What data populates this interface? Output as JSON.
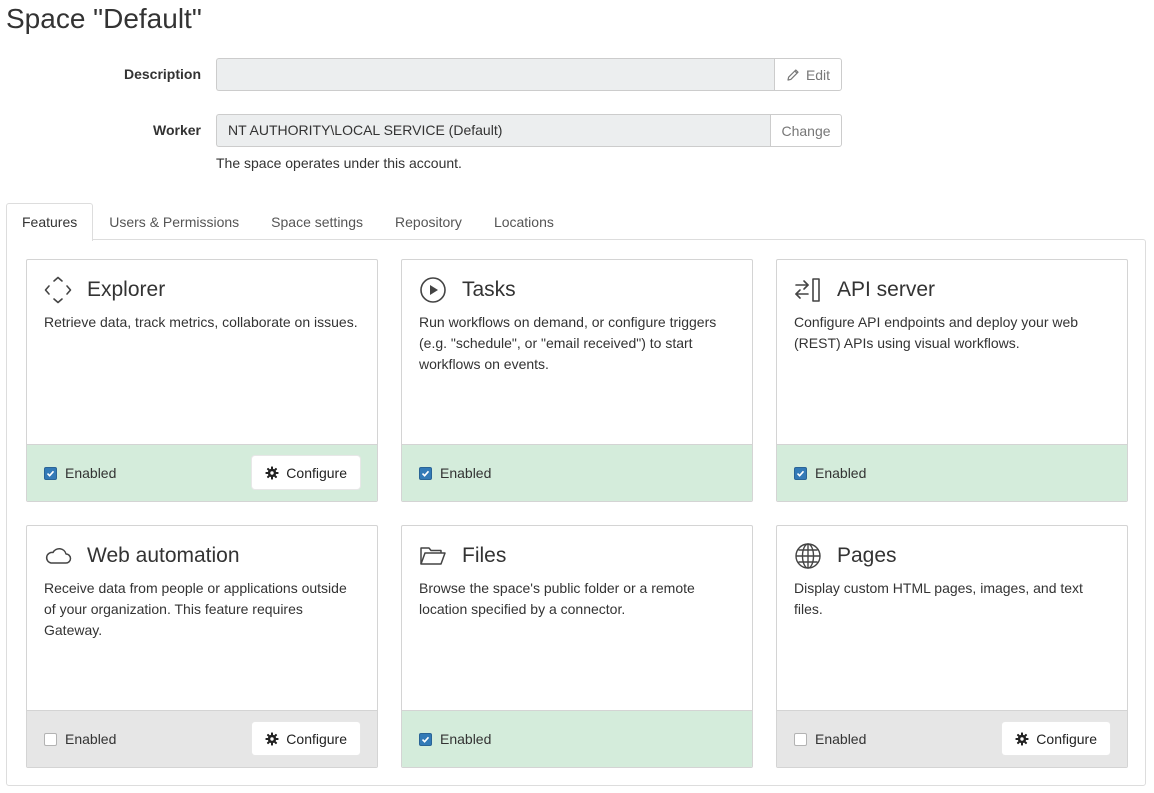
{
  "page": {
    "title": "Space \"Default\""
  },
  "form": {
    "description": {
      "label": "Description",
      "value": "",
      "button": "Edit"
    },
    "worker": {
      "label": "Worker",
      "value": "NT AUTHORITY\\LOCAL SERVICE (Default)",
      "button": "Change",
      "help": "The space operates under this account."
    }
  },
  "tabs": [
    "Features",
    "Users & Permissions",
    "Space settings",
    "Repository",
    "Locations"
  ],
  "features": [
    {
      "title": "Explorer",
      "icon": "explorer-diamond-icon",
      "description": "Retrieve data, track metrics, collaborate on issues.",
      "enabled_label": "Enabled",
      "enabled": true,
      "configure": "Configure"
    },
    {
      "title": "Tasks",
      "icon": "play-circle-icon",
      "description": "Run workflows on demand, or configure triggers (e.g. \"schedule\", or \"email received\") to start workflows on events.",
      "enabled_label": "Enabled",
      "enabled": true
    },
    {
      "title": "API server",
      "icon": "api-exchange-icon",
      "description": "Configure API endpoints and deploy your web (REST) APIs using visual workflows.",
      "enabled_label": "Enabled",
      "enabled": true
    },
    {
      "title": "Web automation",
      "icon": "cloud-icon",
      "description": "Receive data from people or applications outside of your organization. This feature requires Gateway.",
      "enabled_label": "Enabled",
      "enabled": false,
      "configure": "Configure"
    },
    {
      "title": "Files",
      "icon": "folder-open-icon",
      "description": "Browse the space's public folder or a remote location specified by a connector.",
      "enabled_label": "Enabled",
      "enabled": true
    },
    {
      "title": "Pages",
      "icon": "globe-icon",
      "description": "Display custom HTML pages, images, and text files.",
      "enabled_label": "Enabled",
      "enabled": false,
      "configure": "Configure"
    }
  ],
  "colors": {
    "enabled_footer": "#d4ecdb",
    "disabled_footer": "#e6e6e6",
    "checkbox": "#337ab7"
  }
}
